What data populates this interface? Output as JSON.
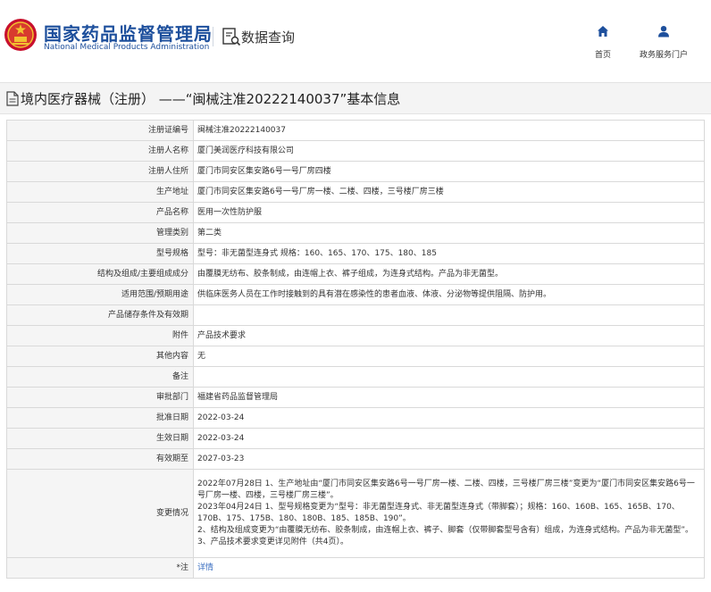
{
  "header": {
    "site_name_cn": "国家药品监督管理局",
    "site_name_en": "National Medical Products Administration",
    "query_label": "数据查询",
    "nav": [
      {
        "label": "首页",
        "icon": "home-icon"
      },
      {
        "label": "政务服务门户",
        "icon": "user-icon"
      }
    ]
  },
  "title": {
    "text": "境内医疗器械（注册） ——“闽械注准20222140037”基本信息"
  },
  "rows": [
    {
      "label": "注册证编号",
      "value": "闽械注准20222140037"
    },
    {
      "label": "注册人名称",
      "value": "厦门美润医疗科技有限公司"
    },
    {
      "label": "注册人住所",
      "value": "厦门市同安区集安路6号一号厂房四楼"
    },
    {
      "label": "生产地址",
      "value": "厦门市同安区集安路6号一号厂房一楼、二楼、四楼，三号楼厂房三楼"
    },
    {
      "label": "产品名称",
      "value": "医用一次性防护服"
    },
    {
      "label": "管理类别",
      "value": "第二类"
    },
    {
      "label": "型号规格",
      "value": "型号：非无菌型连身式 规格：160、165、170、175、180、185"
    },
    {
      "label": "结构及组成/主要组成成分",
      "value": "由覆膜无纺布、胶条制成，由连帽上衣、裤子组成，为连身式结构。产品为非无菌型。"
    },
    {
      "label": "适用范围/预期用途",
      "value": "供临床医务人员在工作时接触到的具有潜在感染性的患者血液、体液、分泌物等提供阻隔、防护用。"
    },
    {
      "label": "产品储存条件及有效期",
      "value": ""
    },
    {
      "label": "附件",
      "value": "产品技术要求"
    },
    {
      "label": "其他内容",
      "value": "无"
    },
    {
      "label": "备注",
      "value": ""
    },
    {
      "label": "审批部门",
      "value": "福建省药品监督管理局"
    },
    {
      "label": "批准日期",
      "value": "2022-03-24"
    },
    {
      "label": "生效日期",
      "value": "2022-03-24"
    },
    {
      "label": "有效期至",
      "value": "2027-03-23"
    }
  ],
  "changes": {
    "label": "变更情况",
    "items": [
      "2022年07月28日 1、生产地址由“厦门市同安区集安路6号一号厂房一楼、二楼、四楼，三号楼厂房三楼”变更为“厦门市同安区集安路6号一号厂房一楼、四楼，三号楼厂房三楼”。",
      "2023年04月24日 1、型号规格变更为“型号：非无菌型连身式、非无菌型连身式（带脚套）；规格：160、160B、165、165B、170、170B、175、175B、180、180B、185、185B、190”。",
      "2、结构及组成变更为“由覆膜无纺布、胶条制成，由连帽上衣、裤子、脚套（仅带脚套型号含有）组成，为连身式结构。产品为非无菌型”。",
      "3、产品技术要求变更详见附件（共4页）。"
    ]
  },
  "footnote": {
    "label": "注",
    "value": "详情"
  }
}
